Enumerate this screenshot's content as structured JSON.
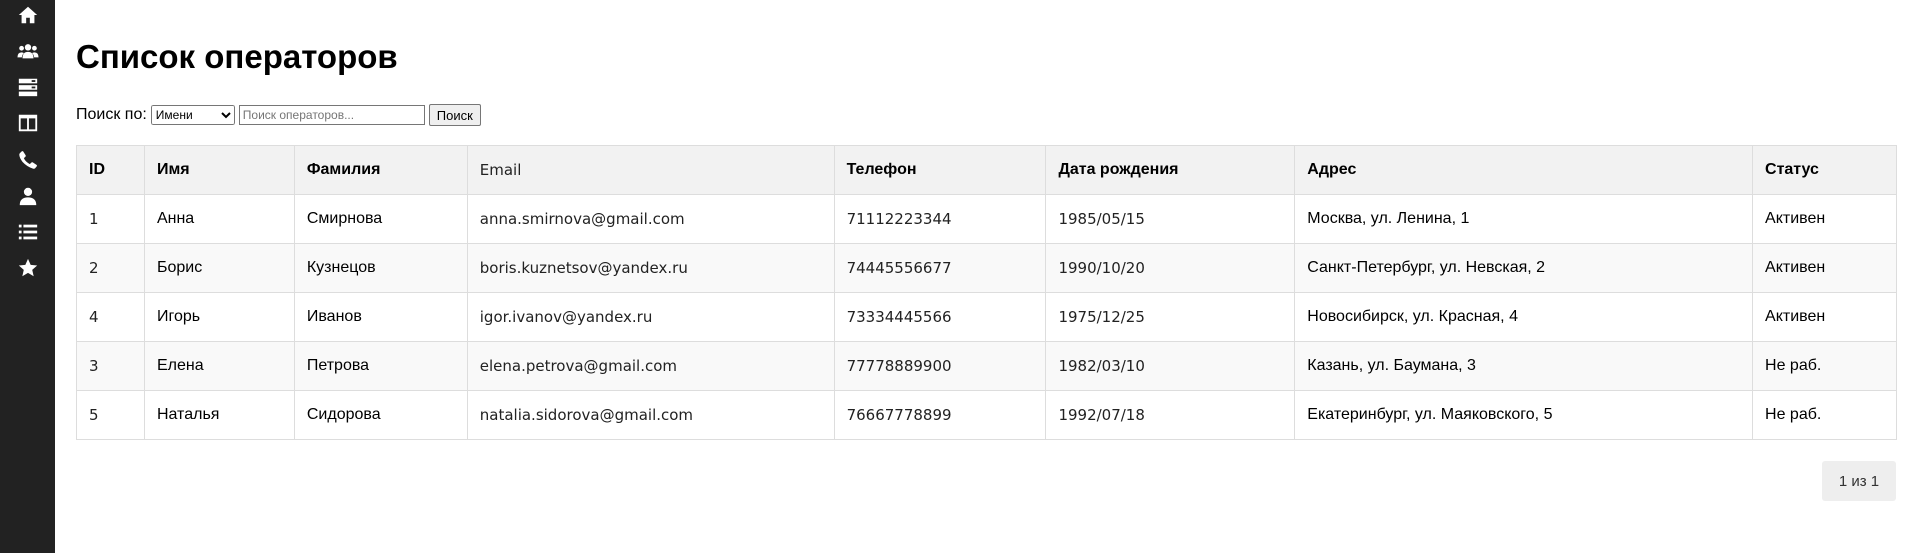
{
  "sidebar": {
    "items": [
      {
        "icon": "home-icon"
      },
      {
        "icon": "users-icon"
      },
      {
        "icon": "server-icon"
      },
      {
        "icon": "columns-icon"
      },
      {
        "icon": "phone-icon"
      },
      {
        "icon": "user-icon"
      },
      {
        "icon": "list-icon"
      },
      {
        "icon": "star-icon"
      }
    ]
  },
  "page": {
    "title": "Список операторов"
  },
  "search": {
    "label": "Поиск по:",
    "select_value": "Имени",
    "placeholder": "Поиск операторов...",
    "button_label": "Поиск"
  },
  "table": {
    "headers": [
      "ID",
      "Имя",
      "Фамилия",
      "Email",
      "Телефон",
      "Дата рождения",
      "Адрес",
      "Статус"
    ],
    "rows": [
      [
        "1",
        "Анна",
        "Смирнова",
        "anna.smirnova@gmail.com",
        "71112223344",
        "1985/05/15",
        "Москва, ул. Ленина, 1",
        "Активен"
      ],
      [
        "2",
        "Борис",
        "Кузнецов",
        "boris.kuznetsov@yandex.ru",
        "74445556677",
        "1990/10/20",
        "Санкт-Петербург, ул. Невская, 2",
        "Активен"
      ],
      [
        "4",
        "Игорь",
        "Иванов",
        "igor.ivanov@yandex.ru",
        "73334445566",
        "1975/12/25",
        "Новосибирск, ул. Красная, 4",
        "Активен"
      ],
      [
        "3",
        "Елена",
        "Петрова",
        "elena.petrova@gmail.com",
        "77778889900",
        "1982/03/10",
        "Казань, ул. Баумана, 3",
        "Не раб."
      ],
      [
        "5",
        "Наталья",
        "Сидорова",
        "natalia.sidorova@gmail.com",
        "76667778899",
        "1992/07/18",
        "Екатеринбург, ул. Маяковского, 5",
        "Не раб."
      ]
    ]
  },
  "pagination": {
    "label": "1 из 1"
  }
}
